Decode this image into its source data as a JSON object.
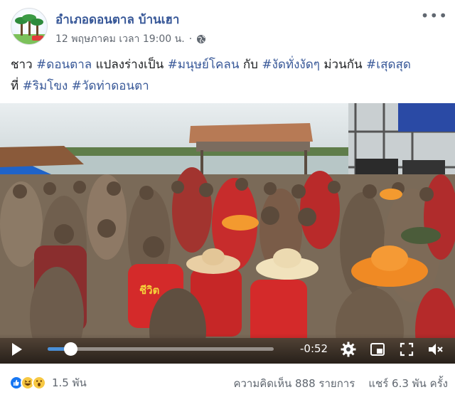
{
  "post": {
    "page_name": "อำเภอดอนตาล บ้านเฮา",
    "timestamp": "12 พฤษภาคม เวลา 19:00 น.",
    "separator": "·",
    "more": "•••",
    "text_line1": [
      {
        "t": "ชาว ",
        "tag": false
      },
      {
        "t": "#ดอนตาล",
        "tag": true
      },
      {
        "t": " แปลงร่างเป็น ",
        "tag": false
      },
      {
        "t": "#มนุษย์โคลน",
        "tag": true
      },
      {
        "t": " กับ ",
        "tag": false
      },
      {
        "t": "#งัดทั่งงัดๆ",
        "tag": true
      },
      {
        "t": " ม่วนกัน ",
        "tag": false
      },
      {
        "t": "#เสุดสุด",
        "tag": true
      }
    ],
    "text_line2": [
      {
        "t": "ที่ ",
        "tag": false
      },
      {
        "t": "#ริมโขง",
        "tag": true
      },
      {
        "t": " ",
        "tag": false
      },
      {
        "t": "#วัดท่าดอนตา",
        "tag": true
      }
    ]
  },
  "video": {
    "shirt_text": "ชีวิต",
    "time_remaining": "-0:52",
    "progress": 0.1
  },
  "footer": {
    "reaction_count": "1.5 พัน",
    "comments": "ความคิดเห็น 888 รายการ",
    "shares": "แชร์ 6.3 พัน ครั้ง"
  },
  "colors": {
    "link": "#385898",
    "progress": "#4a90d9",
    "like": "#1877f2"
  }
}
